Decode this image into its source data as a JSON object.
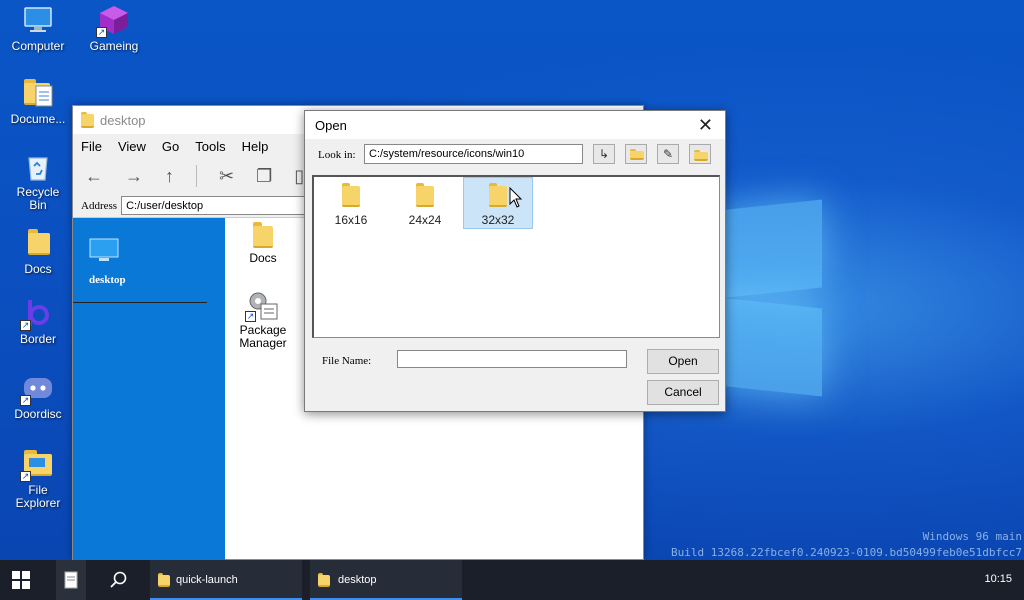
{
  "desktop": {
    "icons": [
      {
        "label": "Computer",
        "icon": "computer-icon"
      },
      {
        "label": "Gameing",
        "icon": "gameing-icon"
      },
      {
        "label": "Docume...",
        "icon": "documents-icon"
      },
      {
        "label": "Recycle\nBin",
        "icon": "recycle-bin-icon"
      },
      {
        "label": "Docs",
        "icon": "folder-icon"
      },
      {
        "label": "Border",
        "icon": "border-app-icon"
      },
      {
        "label": "Doordisc",
        "icon": "doordisc-icon"
      },
      {
        "label": "File\nExplorer",
        "icon": "file-explorer-icon"
      }
    ],
    "watermark_line1": "Windows 96 main",
    "watermark_line2": "Build 13268.22fbcef0.240923-0109.bd50499feb0e51dbfcc7"
  },
  "explorer": {
    "title": "desktop",
    "menu": [
      "File",
      "View",
      "Go",
      "Tools",
      "Help"
    ],
    "address_label": "Address",
    "address_value": "C:/user/desktop",
    "sidebar_title": "desktop",
    "items": [
      {
        "label": "Docs",
        "icon": "folder-icon"
      },
      {
        "label": "Package\nManager",
        "icon": "package-manager-icon"
      }
    ]
  },
  "dialog": {
    "title": "Open",
    "look_in_label": "Look in:",
    "look_in_value": "C:/system/resource/icons/win10",
    "folders": [
      {
        "label": "16x16",
        "selected": false
      },
      {
        "label": "24x24",
        "selected": false
      },
      {
        "label": "32x32",
        "selected": true
      }
    ],
    "file_name_label": "File Name:",
    "file_name_value": "",
    "open_label": "Open",
    "cancel_label": "Cancel"
  },
  "taskbar": {
    "items": [
      {
        "label": "quick-launch"
      },
      {
        "label": "desktop"
      }
    ],
    "clock": "10:15"
  },
  "colors": {
    "accent": "#0a78d7",
    "taskbar": "#1a1f2a",
    "selection": "#cce4f7",
    "folder": "#f7d46a"
  }
}
